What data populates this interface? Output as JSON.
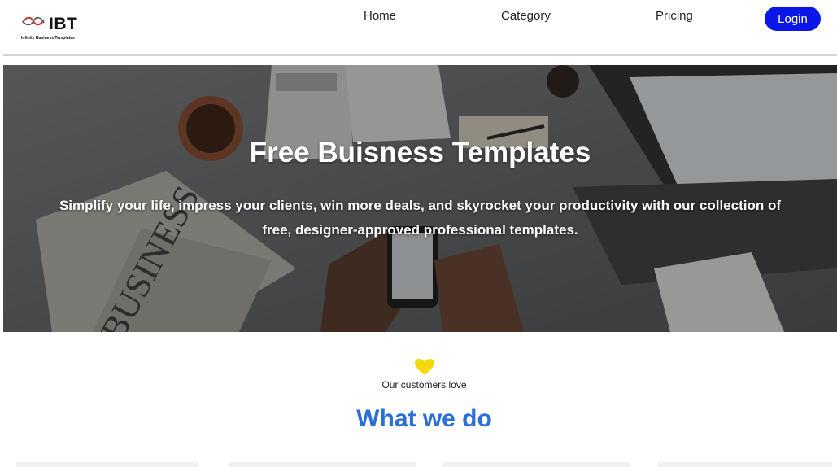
{
  "brand": {
    "name": "IBT",
    "tagline": "Infinity Business Templates",
    "accent": "#c0392b"
  },
  "nav": {
    "home": "Home",
    "category": "Category",
    "pricing": "Pricing",
    "login": "Login",
    "login_color": "#0a17e8"
  },
  "hero": {
    "title": "Free Buisness Templates",
    "subtitle": "Simplify your life, impress your clients, win more deals, and skyrocket your productivity with our collection of free, designer-approved professional templates.",
    "newspaper_text": "BUSINESS"
  },
  "section": {
    "icon": "heart-icon",
    "icon_color": "#f5d90a",
    "love_text": "Our customers love",
    "heading": "What we do",
    "heading_color": "#2a6fd6"
  }
}
